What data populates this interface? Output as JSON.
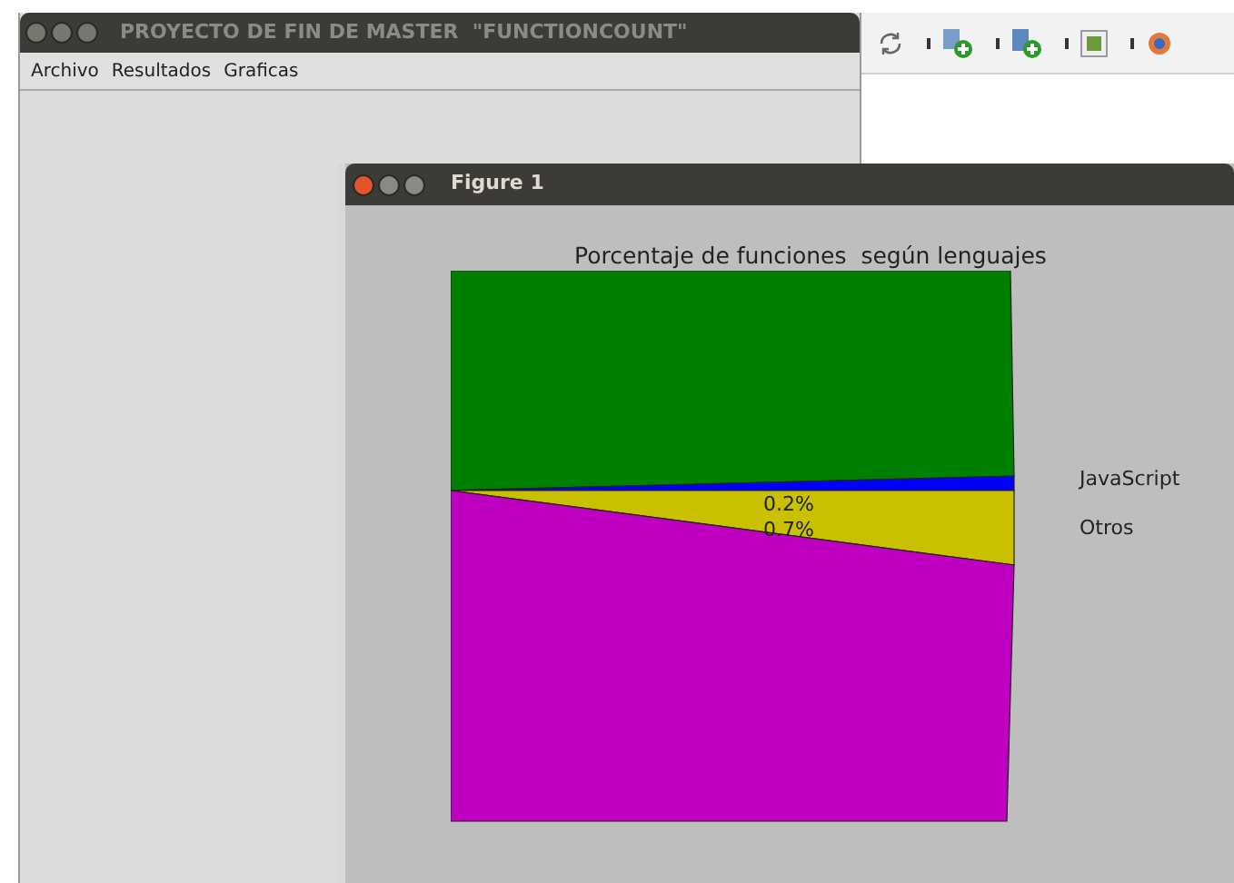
{
  "main_window": {
    "title": "PROYECTO DE FIN DE MASTER  \"FUNCTIONCOUNT\"",
    "active": false,
    "menu": [
      "Archivo",
      "Resultados",
      "Graficas"
    ]
  },
  "figure_window": {
    "title": "Figure 1",
    "active": true,
    "chart": {
      "title": "Porcentaje de funciones  según lenguajes",
      "slices": [
        {
          "color": "#008000"
        },
        {
          "color": "#0000ff",
          "value_label": "0.2%",
          "legend": "JavaScript"
        },
        {
          "color": "#c8c000",
          "value_label": "0.7%",
          "legend": "Otros"
        },
        {
          "color": "#c000c0"
        }
      ]
    }
  }
}
